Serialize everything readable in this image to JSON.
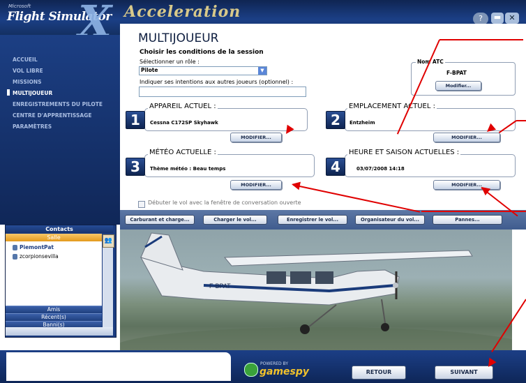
{
  "app": {
    "brand_small": "Microsoft",
    "brand": "Flight Simulator",
    "brand_x": "X",
    "edition": "Acceleration",
    "help_icon": "?",
    "min_icon": "▬",
    "close_icon": "✕"
  },
  "sidebar": {
    "items": [
      {
        "label": "ACCUEIL"
      },
      {
        "label": "VOL LIBRE"
      },
      {
        "label": "MISSIONS"
      },
      {
        "label": "MULTIJOUEUR"
      },
      {
        "label": "ENREGISTREMENTS DU PILOTE"
      },
      {
        "label": "CENTRE D'APPRENTISSAGE"
      },
      {
        "label": "PARAMÈTRES"
      }
    ],
    "active_index": 3
  },
  "main": {
    "title": "MULTIJOUEUR",
    "conditions_title": "Choisir les conditions de la session",
    "role_label": "Sélectionner un rôle :",
    "role_value": "Pilote",
    "intent_label": "Indiquer ses intentions aux autres joueurs (optionnel) :",
    "intent_value": "",
    "atc": {
      "label": "Nom ATC",
      "value": "F-BPAT",
      "button": "Modifier..."
    },
    "sections": [
      {
        "number": "1",
        "title": "APPAREIL ACTUEL :",
        "value": "Cessna C172SP Skyhawk",
        "button": "MODIFIER..."
      },
      {
        "number": "2",
        "title": "EMPLACEMENT ACTUEL :",
        "value": "Entzheim",
        "button": "MODIFIER..."
      },
      {
        "number": "3",
        "title": "MÉTÉO ACTUELLE :",
        "value": "Thème météo : Beau temps",
        "button": "MODIFIER..."
      },
      {
        "number": "4",
        "title": "HEURE ET SAISON ACTUELLES :",
        "value": "03/07/2008 14:18",
        "button": "MODIFIER..."
      }
    ],
    "chat_checkbox": {
      "label": "Débuter le vol avec la fenêtre de conversation ouverte",
      "checked": false
    }
  },
  "action_bar": {
    "buttons": [
      "Carburant et charge...",
      "Charger le vol...",
      "Enregistrer le vol...",
      "Organisateur du vol...",
      "Pannes..."
    ]
  },
  "scene": {
    "aircraft_reg": "F-BPAT"
  },
  "contacts": {
    "title": "Contacts",
    "room_tab": "Salle",
    "people": [
      {
        "name": "PiemontPat",
        "highlight": true
      },
      {
        "name": "zcorpionsevilla",
        "highlight": false
      }
    ],
    "tabs": [
      "Amis",
      "Récent(s)",
      "Banni(s)"
    ]
  },
  "footer": {
    "powered": "POWERED BY",
    "gamespy": "gamespy",
    "back": "RETOUR",
    "next": "SUIVANT"
  },
  "colors": {
    "brand_blue": "#1b3f86",
    "annotation_red": "#e00000",
    "room_orange": "#e49a1b"
  }
}
